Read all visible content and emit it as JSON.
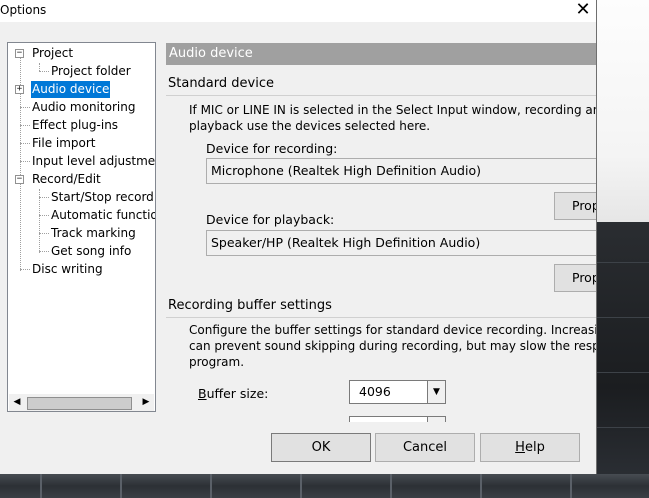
{
  "window": {
    "title": "Options",
    "close_glyph": "✕"
  },
  "tree": {
    "items": [
      {
        "label": "Project",
        "level": 0,
        "expander": "minus"
      },
      {
        "label": "Project folder",
        "level": 1
      },
      {
        "label": "Audio device",
        "level": 0,
        "expander": "plus",
        "selected": true
      },
      {
        "label": "Audio monitoring",
        "level": 0
      },
      {
        "label": "Effect plug-ins",
        "level": 0
      },
      {
        "label": "File import",
        "level": 0
      },
      {
        "label": "Input level adjustmer",
        "level": 0
      },
      {
        "label": "Record/Edit",
        "level": 0,
        "expander": "minus"
      },
      {
        "label": "Start/Stop record",
        "level": 1
      },
      {
        "label": "Automatic function",
        "level": 1
      },
      {
        "label": "Track marking",
        "level": 1
      },
      {
        "label": "Get song info",
        "level": 1
      },
      {
        "label": "Disc writing",
        "level": 0
      }
    ],
    "scroll_left_glyph": "◀",
    "scroll_right_glyph": "▶"
  },
  "panel": {
    "header": "Audio device",
    "standard_device": {
      "title": "Standard device",
      "description_line1": "If MIC or LINE IN is selected in the Select Input window, recording and",
      "description_line2": "playback use the devices selected here.",
      "recording_label": "Device for recording:",
      "recording_value": "Microphone (Realtek High Definition Audio)",
      "properties_label": "Properties",
      "playback_label": "Device for playback:",
      "playback_value": "Speaker/HP (Realtek High Definition Audio)"
    },
    "buffer": {
      "title": "Recording buffer settings",
      "description_line1": "Configure the buffer settings for standard device recording. Increasing",
      "description_line2": "can prevent sound skipping during recording, but may slow the respo",
      "description_line3": "program.",
      "buffer_size_label_first": "B",
      "buffer_size_label_rest": "uffer size:",
      "buffer_size_value": "4096",
      "dropdown_glyph": "▼"
    }
  },
  "footer": {
    "ok": "OK",
    "cancel": "Cancel",
    "help_first": "H",
    "help_rest": "elp"
  }
}
